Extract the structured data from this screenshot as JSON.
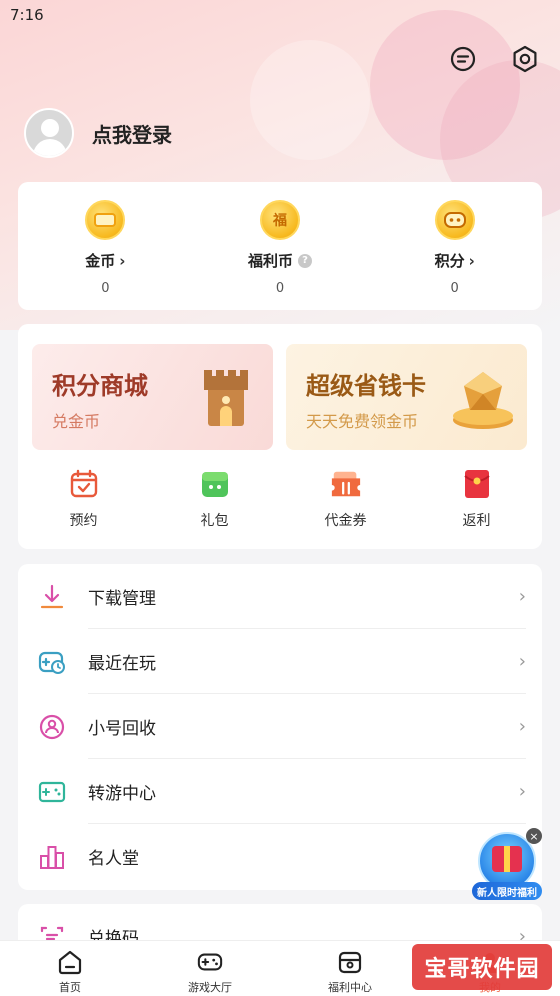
{
  "status_bar": {
    "time": "7:16"
  },
  "header": {
    "icons": [
      "message-icon",
      "settings-icon"
    ]
  },
  "profile": {
    "login_text": "点我登录"
  },
  "wallet": {
    "items": [
      {
        "label": "金币",
        "value": "0",
        "icon": "gold-coin-icon"
      },
      {
        "label": "福利币",
        "value": "0",
        "icon": "welfare-coin-icon",
        "coin_char": "福"
      },
      {
        "label": "积分",
        "value": "0",
        "icon": "points-icon"
      }
    ]
  },
  "promo": {
    "banners": [
      {
        "title": "积分商城",
        "subtitle": "兑金币"
      },
      {
        "title": "超级省钱卡",
        "subtitle": "天天免费领金币"
      }
    ],
    "shortcuts": [
      {
        "label": "预约",
        "icon": "calendar-icon"
      },
      {
        "label": "礼包",
        "icon": "gift-pack-icon"
      },
      {
        "label": "代金券",
        "icon": "voucher-icon"
      },
      {
        "label": "返利",
        "icon": "red-envelope-icon"
      }
    ]
  },
  "menu": {
    "items": [
      {
        "label": "下载管理",
        "icon": "download-icon"
      },
      {
        "label": "最近在玩",
        "icon": "recent-game-icon"
      },
      {
        "label": "小号回收",
        "icon": "account-recycle-icon"
      },
      {
        "label": "转游中心",
        "icon": "transfer-game-icon"
      },
      {
        "label": "名人堂",
        "icon": "hall-of-fame-icon"
      },
      {
        "label": "兑换码",
        "icon": "redeem-code-icon"
      }
    ]
  },
  "floating_badge": {
    "label": "新人限时福利"
  },
  "tabbar": {
    "tabs": [
      {
        "label": "首页",
        "icon": "home-icon"
      },
      {
        "label": "游戏大厅",
        "icon": "gamepad-icon"
      },
      {
        "label": "福利中心",
        "icon": "welfare-center-icon"
      },
      {
        "label": "我的",
        "icon": "profile-icon"
      }
    ]
  },
  "watermark": {
    "text": "宝哥软件园"
  },
  "colors": {
    "accent": "#f0664a",
    "menu_icon": "#d94fa8",
    "coin": "#f7b91f"
  }
}
